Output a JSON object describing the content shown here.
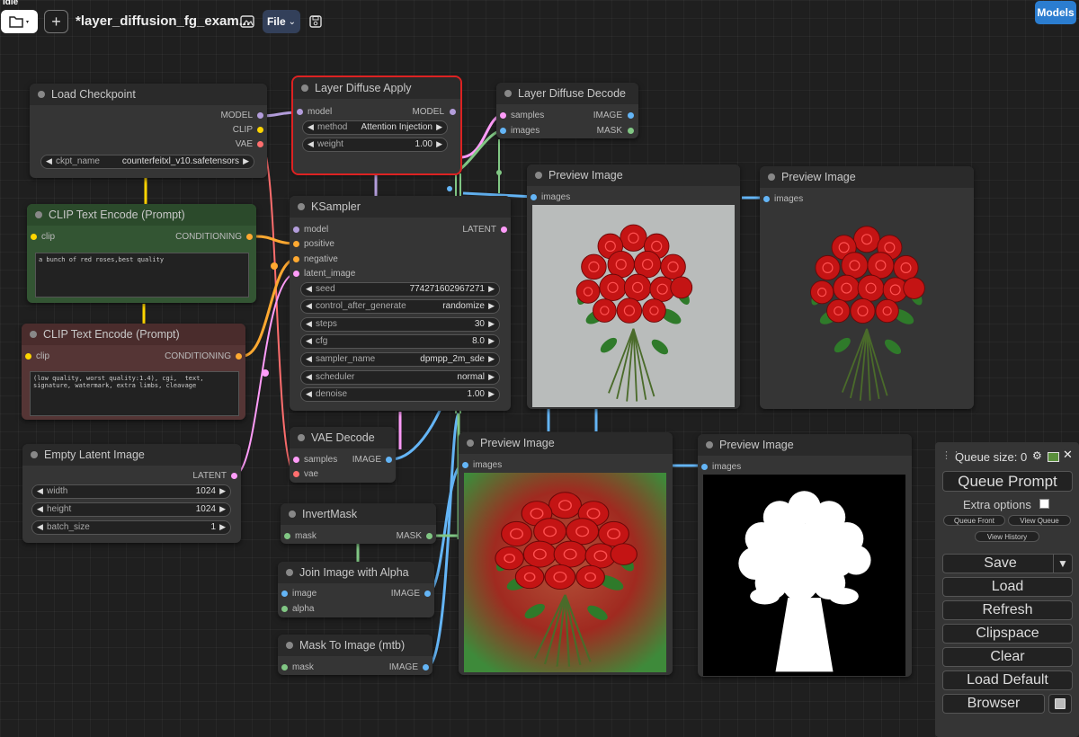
{
  "status": "Idle",
  "topbar": {
    "workflow_title": "*layer_diffusion_fg_exam...",
    "file_menu_label": "File"
  },
  "models_button": "Models",
  "nodes": {
    "load_checkpoint": {
      "title": "Load Checkpoint",
      "outputs": [
        "MODEL",
        "CLIP",
        "VAE"
      ],
      "ckpt_label": "ckpt_name",
      "ckpt_value": "counterfeitxl_v10.safetensors"
    },
    "layer_diffuse_apply": {
      "title": "Layer Diffuse Apply",
      "input": "model",
      "output": "MODEL",
      "method_label": "method",
      "method_value": "Attention Injection",
      "weight_label": "weight",
      "weight_value": "1.00"
    },
    "layer_diffuse_decode": {
      "title": "Layer Diffuse Decode",
      "inputs": [
        "samples",
        "images"
      ],
      "outputs": [
        "IMAGE",
        "MASK"
      ]
    },
    "clip_pos": {
      "title": "CLIP Text Encode (Prompt)",
      "input": "clip",
      "output": "CONDITIONING",
      "text": "a bunch of red roses,best quality"
    },
    "clip_neg": {
      "title": "CLIP Text Encode (Prompt)",
      "input": "clip",
      "output": "CONDITIONING",
      "text": "(low quality, worst quality:1.4), cgi,  text, signature, watermark, extra limbs, cleavage"
    },
    "ksampler": {
      "title": "KSampler",
      "inputs": [
        "model",
        "positive",
        "negative",
        "latent_image"
      ],
      "output": "LATENT",
      "widgets": [
        {
          "name": "seed",
          "value": "774271602967271"
        },
        {
          "name": "control_after_generate",
          "value": "randomize"
        },
        {
          "name": "steps",
          "value": "30"
        },
        {
          "name": "cfg",
          "value": "8.0"
        },
        {
          "name": "sampler_name",
          "value": "dpmpp_2m_sde"
        },
        {
          "name": "scheduler",
          "value": "normal"
        },
        {
          "name": "denoise",
          "value": "1.00"
        }
      ]
    },
    "empty_latent": {
      "title": "Empty Latent Image",
      "output": "LATENT",
      "widgets": [
        {
          "name": "width",
          "value": "1024"
        },
        {
          "name": "height",
          "value": "1024"
        },
        {
          "name": "batch_size",
          "value": "1"
        }
      ]
    },
    "vae_decode": {
      "title": "VAE Decode",
      "inputs": [
        "samples",
        "vae"
      ],
      "output": "IMAGE"
    },
    "invert_mask": {
      "title": "InvertMask",
      "input": "mask",
      "output": "MASK"
    },
    "join_alpha": {
      "title": "Join Image with Alpha",
      "inputs": [
        "image",
        "alpha"
      ],
      "output": "IMAGE"
    },
    "mask_to_image": {
      "title": "Mask To Image (mtb)",
      "input": "mask",
      "output": "IMAGE"
    },
    "preview1": {
      "title": "Preview Image",
      "input": "images"
    },
    "preview2": {
      "title": "Preview Image",
      "input": "images"
    },
    "preview3": {
      "title": "Preview Image",
      "input": "images"
    },
    "preview4": {
      "title": "Preview Image",
      "input": "images"
    }
  },
  "queue_panel": {
    "queue_size": "Queue size: 0",
    "queue_prompt": "Queue Prompt",
    "extra_options": "Extra options",
    "queue_front": "Queue Front",
    "view_queue": "View Queue",
    "view_history": "View History",
    "save": "Save",
    "load": "Load",
    "refresh": "Refresh",
    "clipspace": "Clipspace",
    "clear": "Clear",
    "load_default": "Load Default",
    "browser": "Browser"
  },
  "colors": {
    "model": "#b39ddb",
    "clip": "#ffd500",
    "vae": "#ff6e6e",
    "conditioning": "#ffa931",
    "latent": "#ff9cf9",
    "image": "#64b5f6",
    "mask": "#81c784",
    "accent": "#2b7dd0"
  }
}
